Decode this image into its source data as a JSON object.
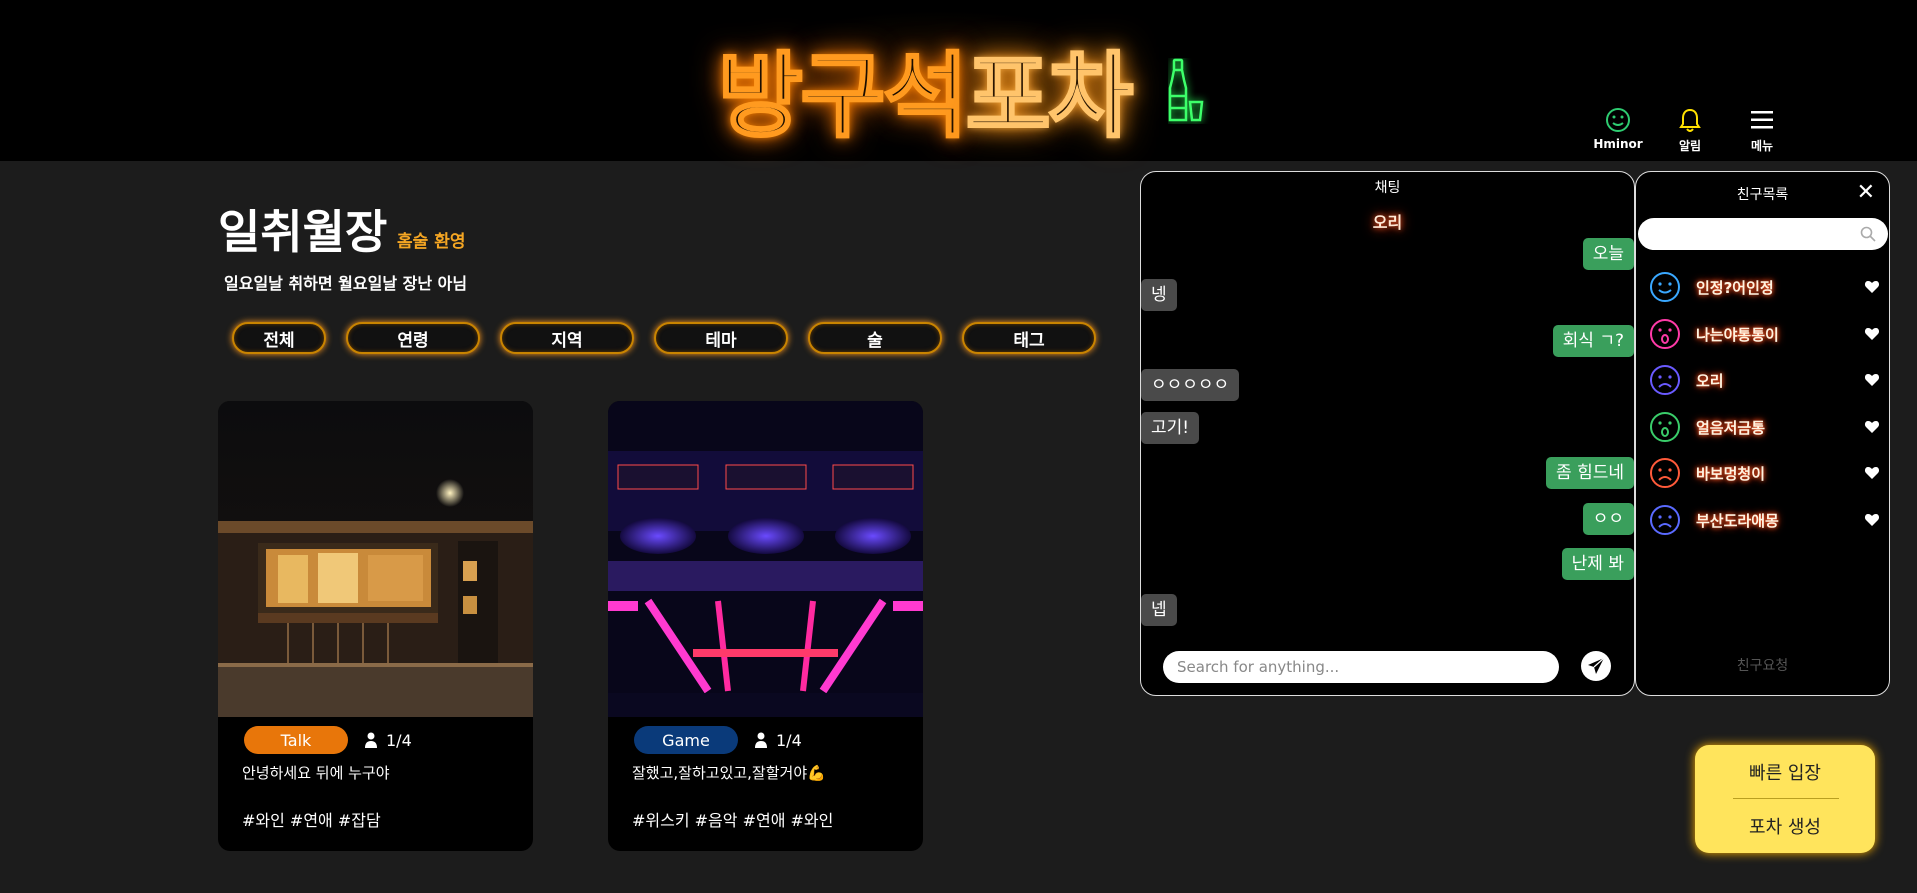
{
  "header": {
    "logo_part1": "방구석",
    "logo_part2": "포차",
    "icons": [
      {
        "label": "Hminor",
        "icon": "smile-icon"
      },
      {
        "label": "알림",
        "icon": "bell-icon"
      },
      {
        "label": "메뉴",
        "icon": "hamburger-menu-icon"
      }
    ]
  },
  "page": {
    "title": "일취월장",
    "title_badge": "홈술 환영",
    "description": "일요일날 취하면 월요일날 장난 아님"
  },
  "filters": [
    "전체",
    "연령",
    "지역",
    "테마",
    "술",
    "태그"
  ],
  "cards": [
    {
      "category": "Talk",
      "category_color": "#e8760a",
      "people": "1/4",
      "text": "안녕하세요 뒤에 누구야",
      "tags": "#와인 #연애 #잡담"
    },
    {
      "category": "Game",
      "category_color": "#0a3a7a",
      "people": "1/4",
      "text": "잘했고,잘하고있고,잘할거야💪",
      "tags": "#위스키 #음악 #연애 #와인"
    }
  ],
  "chat": {
    "title": "채팅",
    "partner": "오리",
    "messages": [
      {
        "side": "right",
        "text": "오늘"
      },
      {
        "side": "left",
        "text": "넹"
      },
      {
        "side": "right",
        "text": "회식 ㄱ?"
      },
      {
        "side": "left",
        "text": "ㅇㅇㅇㅇㅇ"
      },
      {
        "side": "left",
        "text": "고기!"
      },
      {
        "side": "right",
        "text": "좀 힘드네"
      },
      {
        "side": "right",
        "text": "ㅇㅇ"
      },
      {
        "side": "right",
        "text": "난제 봐"
      },
      {
        "side": "left",
        "text": "넵"
      }
    ],
    "input_placeholder": "Search for anything..."
  },
  "friends": {
    "title": "친구목록",
    "close": "✕",
    "list": [
      {
        "name": "인정?어인정",
        "face": "smile",
        "color": "#3aa8ff"
      },
      {
        "name": "나는야통통이",
        "face": "surprised",
        "color": "#ff3aa8"
      },
      {
        "name": "오리",
        "face": "sad",
        "color": "#6a5aff"
      },
      {
        "name": "얼음저금통",
        "face": "surprised",
        "color": "#3acd6a"
      },
      {
        "name": "바보멍청이",
        "face": "sad",
        "color": "#ff5a3a"
      },
      {
        "name": "부산도라애몽",
        "face": "sad",
        "color": "#5a6aff"
      }
    ],
    "request_label": "친구요청"
  },
  "quick_actions": {
    "enter": "빠른 입장",
    "create": "포차 생성"
  }
}
